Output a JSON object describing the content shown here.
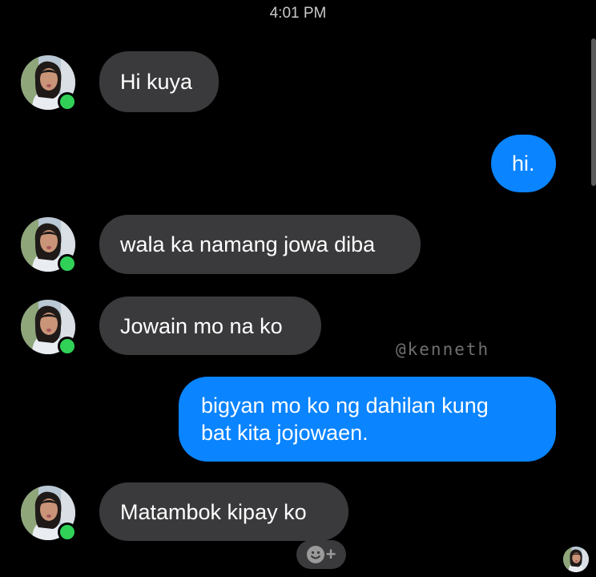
{
  "chat": {
    "timestamp": "4:01 PM",
    "watermark": "@kenneth",
    "messages": [
      {
        "sender": "contact",
        "text": "Hi kuya"
      },
      {
        "sender": "me",
        "text": "hi."
      },
      {
        "sender": "contact",
        "text": "wala ka namang jowa diba"
      },
      {
        "sender": "contact",
        "text": "Jowain mo na ko"
      },
      {
        "sender": "me",
        "lines": [
          "bigyan mo ko ng dahilan kung",
          "bat kita jojowaen."
        ]
      },
      {
        "sender": "contact",
        "text": "Matambok kipay ko"
      }
    ]
  },
  "colors": {
    "background": "#000000",
    "incoming_bubble": "#3a3a3c",
    "outgoing_bubble": "#0a84ff",
    "online_indicator": "#31d158"
  },
  "icons": {
    "avatar": "contact-avatar-icon",
    "online": "online-status-icon",
    "reaction": "add-reaction-icon",
    "read_receipt": "read-receipt-avatar-icon"
  }
}
